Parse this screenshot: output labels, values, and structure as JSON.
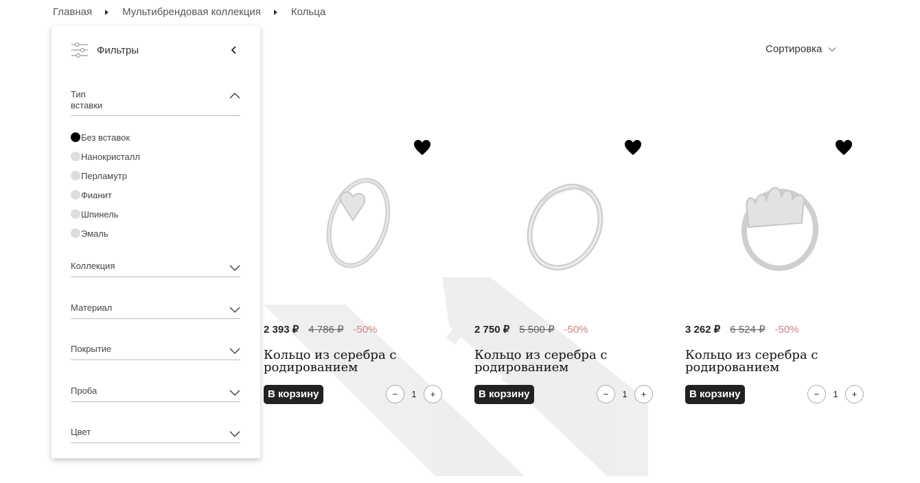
{
  "breadcrumb": [
    "Главная",
    "Мультибрендовая коллекция",
    "Кольца"
  ],
  "filters": {
    "title": "Фильтры",
    "insert_type": {
      "title": "Тип вставки",
      "options": [
        {
          "label": "Без вставок",
          "selected": true
        },
        {
          "label": "Нанокристалл",
          "selected": false
        },
        {
          "label": "Перламутр",
          "selected": false
        },
        {
          "label": "Фианит",
          "selected": false
        },
        {
          "label": "Шпинель",
          "selected": false
        },
        {
          "label": "Эмаль",
          "selected": false
        }
      ]
    },
    "groups": [
      "Коллекция",
      "Материал",
      "Покрытие",
      "Проба",
      "Цвет"
    ]
  },
  "sort": {
    "label": "Сортировка"
  },
  "products": [
    {
      "price": "2 393 ₽",
      "old_price": "4 786 ₽",
      "discount": "-50%",
      "name": "Кольцо из серебра с родированием",
      "cart_label": "В корзину",
      "qty": "1"
    },
    {
      "price": "2 750 ₽",
      "old_price": "5 500 ₽",
      "discount": "-50%",
      "name": "Кольцо из серебра с родированием",
      "cart_label": "В корзину",
      "qty": "1"
    },
    {
      "price": "3 262 ₽",
      "old_price": "6 524 ₽",
      "discount": "-50%",
      "name": "Кольцо из серебра с родированием",
      "cart_label": "В корзину",
      "qty": "1"
    }
  ],
  "stepper": {
    "minus": "−",
    "plus": "+"
  },
  "colors": {
    "accent": "#222222",
    "discount": "#d08080",
    "selected_dot": "#000000",
    "dot": "#dddddd"
  },
  "icons": [
    "filter-icon",
    "chevron-left-icon",
    "chevron-up-icon",
    "chevron-down-icon",
    "heart-icon"
  ]
}
